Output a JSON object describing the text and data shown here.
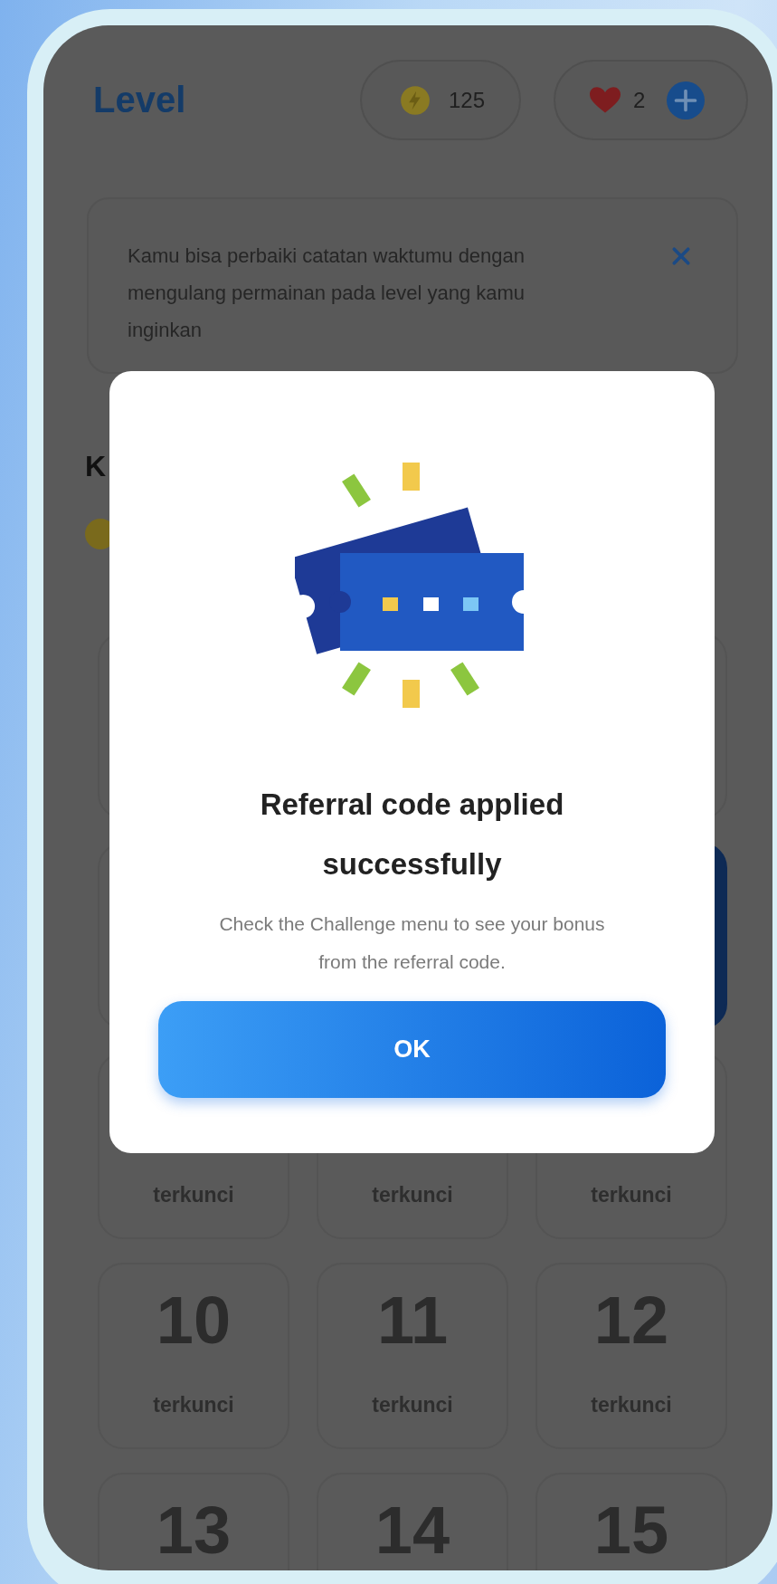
{
  "header": {
    "title": "Level",
    "coins": "125",
    "lives": "2"
  },
  "tip": {
    "text": "Kamu bisa perbaiki catatan waktumu dengan mengulang permainan pada level yang kamu inginkan"
  },
  "section": {
    "title": "K"
  },
  "levels": [
    {
      "status": "terkunci"
    },
    {
      "status": "terkunci"
    },
    {
      "status": "terkunci"
    },
    {
      "number": "10",
      "status": "terkunci"
    },
    {
      "number": "11",
      "status": "terkunci"
    },
    {
      "number": "12",
      "status": "terkunci"
    },
    {
      "number": "13"
    },
    {
      "number": "14"
    },
    {
      "number": "15"
    }
  ],
  "modal": {
    "title": "Referral code applied successfully",
    "message": "Check the Challenge menu to see your bonus from the referral code.",
    "button": "OK"
  }
}
